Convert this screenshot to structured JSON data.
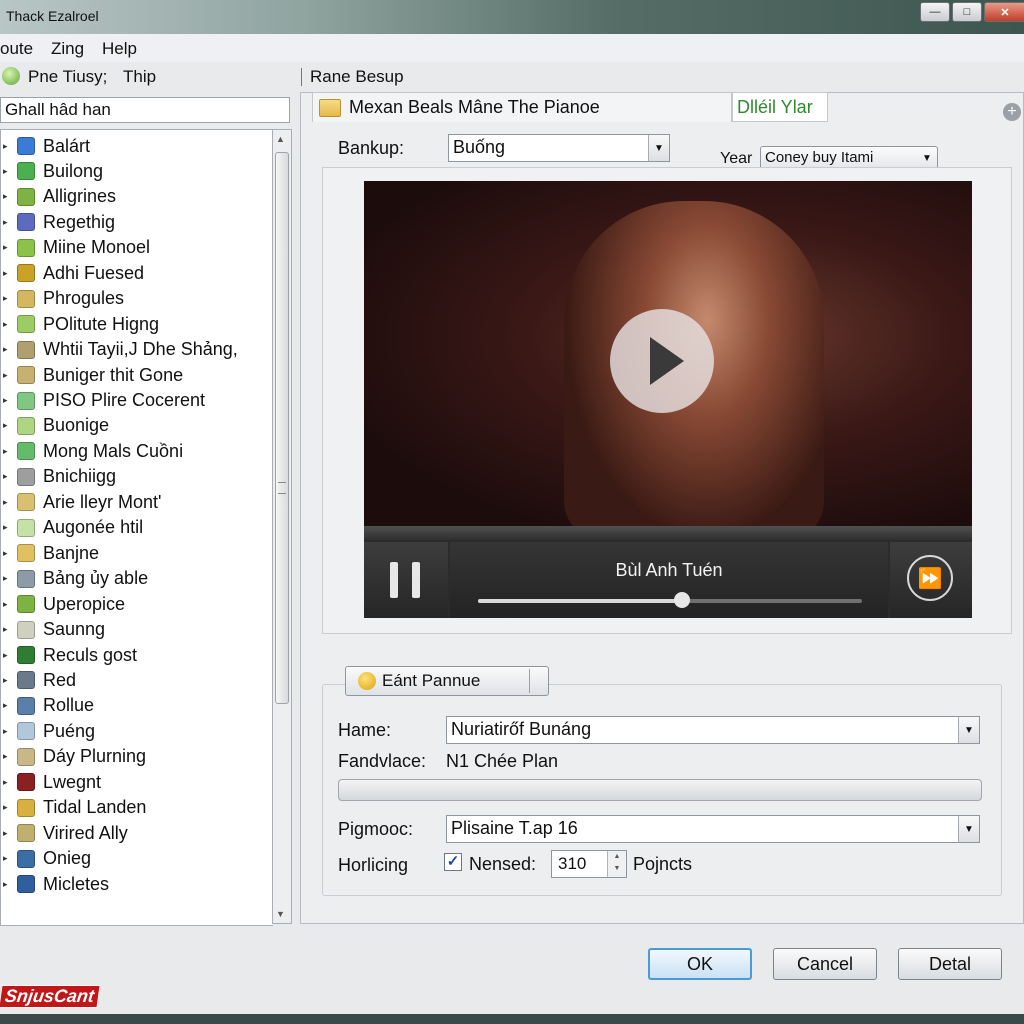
{
  "window": {
    "title": "Thack Ezalroel",
    "minimize_label": "—",
    "maximize_label": "□",
    "close_label": "✕"
  },
  "menu": [
    "oute",
    "Zing",
    "Help"
  ],
  "toolbar": {
    "item1": "Pne Tiusy;",
    "item2": "Thip",
    "item3": "Rane Besup"
  },
  "sidebar": {
    "search_value": "Ghall hâd han",
    "items": [
      {
        "label": "Balárt",
        "color": "#3a7bd5"
      },
      {
        "label": "Builong",
        "color": "#4caf50"
      },
      {
        "label": "Alligrines",
        "color": "#7cb342"
      },
      {
        "label": "Regethig",
        "color": "#5c6bc0"
      },
      {
        "label": "Miine Monoel",
        "color": "#8bc34a"
      },
      {
        "label": "Adhi Fuesed",
        "color": "#c9a227"
      },
      {
        "label": "Phrogules",
        "color": "#d4b860"
      },
      {
        "label": "POlitute Higng",
        "color": "#9ccc65"
      },
      {
        "label": "Whtii Tayii,J Dhe Shảng,",
        "color": "#b0a070"
      },
      {
        "label": "Buniger thit Gone",
        "color": "#c8b070"
      },
      {
        "label": "PISO Plire Cocerent",
        "color": "#81c784"
      },
      {
        "label": "Buonige",
        "color": "#aed581"
      },
      {
        "label": "Mong Mals Cuồni",
        "color": "#66bb6a"
      },
      {
        "label": "Bnichiigg",
        "color": "#9e9e9e"
      },
      {
        "label": "Arie lleyr Mont'",
        "color": "#d8c070"
      },
      {
        "label": "Augonée htil",
        "color": "#c5e1a5"
      },
      {
        "label": "Banjne",
        "color": "#e0c060"
      },
      {
        "label": "Bảng ủy able",
        "color": "#8d9aa8"
      },
      {
        "label": "Uperopice",
        "color": "#7cb342"
      },
      {
        "label": "Saunng",
        "color": "#d0d0c0"
      },
      {
        "label": "Reculs gost",
        "color": "#2e7d32"
      },
      {
        "label": "Red",
        "color": "#6a7a8a"
      },
      {
        "label": "Rollue",
        "color": "#5a7fa8"
      },
      {
        "label": "Puéng",
        "color": "#b0c8d8"
      },
      {
        "label": "Dáy Plurning",
        "color": "#c8b888"
      },
      {
        "label": "Lwegnt",
        "color": "#8b2020"
      },
      {
        "label": "Tidal Landen",
        "color": "#d8b040"
      },
      {
        "label": "Virired Ally",
        "color": "#c0b070"
      },
      {
        "label": "Onieg",
        "color": "#3a6ea5"
      },
      {
        "label": "Micletes",
        "color": "#2f5f9f"
      }
    ]
  },
  "tabs": {
    "active": "Mexan Beals Mâne The Pianoe",
    "second": "Dlléil Ylar",
    "second_color": "#2f8a2f"
  },
  "backup": {
    "label": "Bankup:",
    "value": "Buống",
    "year_label": "Year",
    "year_value": "Coney buy Itami"
  },
  "player": {
    "track_title": "Bùl Anh Tuén",
    "progress": 0.53
  },
  "group": {
    "button_label": "Eánt Pannue",
    "name_label": "Hame:",
    "name_value": "Nuriatirőf Bunáng",
    "field2_label": "Fandvlace:",
    "field2_value": "N1 Chée Plan",
    "field3_label": "Pigmooc:",
    "field3_value": "Plisaine T.ap 16",
    "field4_label": "Horlicing",
    "check_label": "Nensed:",
    "checked": true,
    "spin_value": "310",
    "spin_unit": "Pojncts"
  },
  "buttons": {
    "ok": "OK",
    "cancel": "Cancel",
    "detail": "Detal"
  },
  "watermark": "SnjusCant"
}
